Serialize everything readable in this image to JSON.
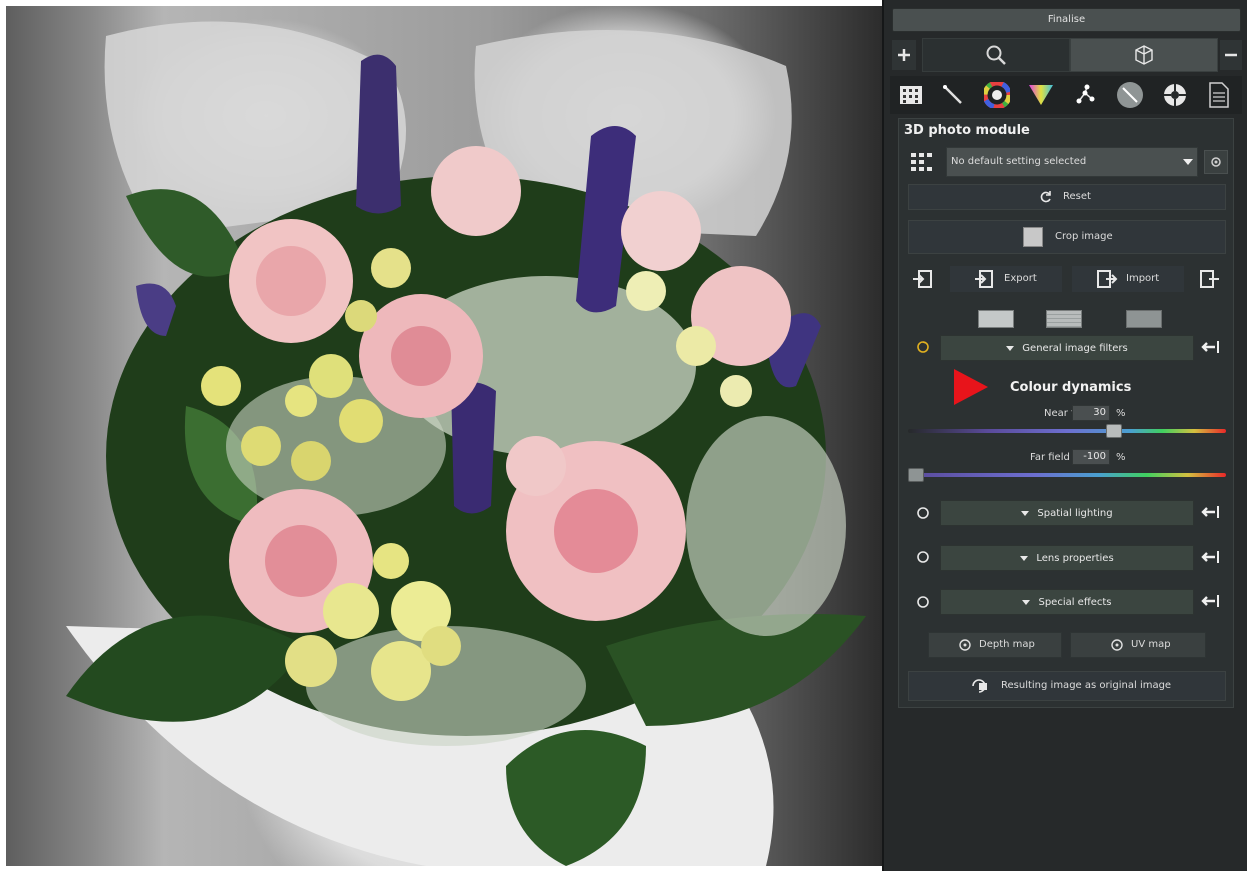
{
  "panel": {
    "finalise_label": "Finalise",
    "module_title": "3D photo module",
    "preset": {
      "value": "No default setting selected"
    },
    "reset_label": "Reset",
    "crop_label": "Crop image",
    "export_label": "Export",
    "import_label": "Import",
    "sections": {
      "general_filters": "General image filters",
      "spatial_lighting": "Spatial lighting",
      "lens_properties": "Lens properties",
      "special_effects": "Special effects"
    },
    "colour_dynamics": {
      "title": "Colour dynamics",
      "near_field": {
        "label": "Near field",
        "value": "30",
        "unit": "%",
        "level": 0.65
      },
      "far_field": {
        "label": "Far field",
        "value": "-100",
        "unit": "%",
        "level": 0.0
      }
    },
    "depth_map_label": "Depth map",
    "uv_map_label": "UV map",
    "resulting_label": "Resulting image as original image"
  },
  "toolbar_icons": [
    "grid-icon",
    "wand-icon",
    "colour-wheel-icon",
    "triangle-palette-icon",
    "nodes-icon",
    "lens-icon",
    "aperture-icon",
    "document-icon"
  ],
  "colors": {
    "panel_bg": "#26292a",
    "bar_bg": "#3b4140",
    "accent_red": "#e8141b",
    "slider_gradient": [
      "#6a4fd8",
      "#3f7fe0",
      "#3fd07a",
      "#e0d040",
      "#e82828"
    ]
  }
}
